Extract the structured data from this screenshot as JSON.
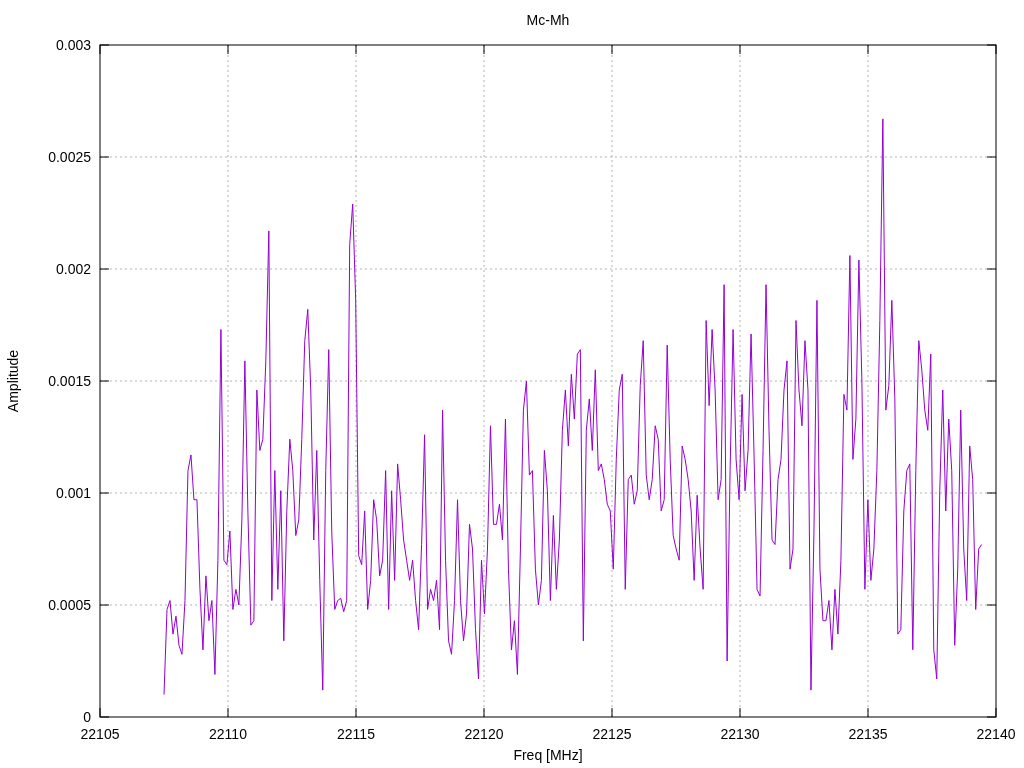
{
  "chart_data": {
    "type": "line",
    "grid": true,
    "title": "Mc-Mh",
    "xlabel": "Freq [MHz]",
    "ylabel": "Amplitude",
    "xlim": [
      22105,
      22140
    ],
    "ylim": [
      0,
      0.003
    ],
    "xticks": [
      22105,
      22110,
      22115,
      22120,
      22125,
      22130,
      22135,
      22140
    ],
    "yticks": [
      {
        "value": 0,
        "label": "0"
      },
      {
        "value": 0.0005,
        "label": "0.0005"
      },
      {
        "value": 0.001,
        "label": "0.001"
      },
      {
        "value": 0.0015,
        "label": "0.0015"
      },
      {
        "value": 0.002,
        "label": "0.002"
      },
      {
        "value": 0.0025,
        "label": "0.0025"
      },
      {
        "value": 0.003,
        "label": "0.003"
      }
    ],
    "x": [
      22107.5,
      22107.617,
      22107.734,
      22107.851,
      22107.968,
      22108.085,
      22108.202,
      22108.319,
      22108.436,
      22108.553,
      22108.67,
      22108.787,
      22108.904,
      22109.021,
      22109.138,
      22109.255,
      22109.372,
      22109.489,
      22109.606,
      22109.723,
      22109.84,
      22109.957,
      22110.074,
      22110.191,
      22110.308,
      22110.425,
      22110.542,
      22110.659,
      22110.776,
      22110.893,
      22111.01,
      22111.127,
      22111.244,
      22111.361,
      22111.478,
      22111.595,
      22111.712,
      22111.829,
      22111.946,
      22112.063,
      22112.18,
      22112.297,
      22112.414,
      22112.531,
      22112.648,
      22112.765,
      22112.882,
      22112.999,
      22113.116,
      22113.233,
      22113.35,
      22113.467,
      22113.584,
      22113.701,
      22113.818,
      22113.935,
      22114.052,
      22114.169,
      22114.286,
      22114.403,
      22114.52,
      22114.637,
      22114.754,
      22114.871,
      22114.988,
      22115.105,
      22115.222,
      22115.339,
      22115.456,
      22115.573,
      22115.69,
      22115.807,
      22115.924,
      22116.041,
      22116.158,
      22116.275,
      22116.392,
      22116.509,
      22116.626,
      22116.743,
      22116.86,
      22116.977,
      22117.094,
      22117.211,
      22117.328,
      22117.445,
      22117.562,
      22117.679,
      22117.796,
      22117.913,
      22118.03,
      22118.147,
      22118.264,
      22118.381,
      22118.498,
      22118.615,
      22118.732,
      22118.849,
      22118.966,
      22119.083,
      22119.2,
      22119.317,
      22119.434,
      22119.551,
      22119.668,
      22119.785,
      22119.902,
      22120.019,
      22120.136,
      22120.253,
      22120.37,
      22120.487,
      22120.604,
      22120.721,
      22120.838,
      22120.955,
      22121.072,
      22121.189,
      22121.306,
      22121.423,
      22121.54,
      22121.657,
      22121.774,
      22121.891,
      22122.008,
      22122.125,
      22122.242,
      22122.359,
      22122.476,
      22122.593,
      22122.71,
      22122.827,
      22122.944,
      22123.061,
      22123.178,
      22123.295,
      22123.412,
      22123.529,
      22123.646,
      22123.763,
      22123.88,
      22123.997,
      22124.114,
      22124.231,
      22124.348,
      22124.465,
      22124.582,
      22124.699,
      22124.816,
      22124.933,
      22125.05,
      22125.167,
      22125.284,
      22125.401,
      22125.518,
      22125.635,
      22125.752,
      22125.869,
      22125.986,
      22126.103,
      22126.22,
      22126.337,
      22126.454,
      22126.571,
      22126.688,
      22126.805,
      22126.922,
      22127.039,
      22127.156,
      22127.273,
      22127.39,
      22127.507,
      22127.624,
      22127.741,
      22127.858,
      22127.975,
      22128.092,
      22128.209,
      22128.326,
      22128.443,
      22128.56,
      22128.677,
      22128.794,
      22128.911,
      22129.028,
      22129.145,
      22129.262,
      22129.379,
      22129.496,
      22129.613,
      22129.73,
      22129.847,
      22129.964,
      22130.081,
      22130.198,
      22130.315,
      22130.432,
      22130.549,
      22130.666,
      22130.783,
      22130.9,
      22131.017,
      22131.134,
      22131.251,
      22131.368,
      22131.485,
      22131.602,
      22131.719,
      22131.836,
      22131.953,
      22132.07,
      22132.187,
      22132.304,
      22132.421,
      22132.538,
      22132.655,
      22132.772,
      22132.889,
      22133.006,
      22133.123,
      22133.24,
      22133.357,
      22133.474,
      22133.591,
      22133.708,
      22133.825,
      22133.942,
      22134.059,
      22134.176,
      22134.293,
      22134.41,
      22134.527,
      22134.644,
      22134.761,
      22134.878,
      22134.995,
      22135.112,
      22135.229,
      22135.346,
      22135.463,
      22135.58,
      22135.697,
      22135.814,
      22135.931,
      22136.048,
      22136.165,
      22136.282,
      22136.399,
      22136.516,
      22136.633,
      22136.75,
      22136.867,
      22136.984,
      22137.101,
      22137.218,
      22137.335,
      22137.452,
      22137.569,
      22137.686,
      22137.803,
      22137.92,
      22138.037,
      22138.154,
      22138.271,
      22138.388,
      22138.505,
      22138.622,
      22138.739,
      22138.856,
      22138.973,
      22139.09,
      22139.207,
      22139.324,
      22139.441
    ],
    "series": [
      {
        "color": "#9400d3",
        "values": [
          0.0001,
          0.00048,
          0.00052,
          0.00037,
          0.00045,
          0.00032,
          0.00028,
          0.00052,
          0.0011,
          0.00117,
          0.00097,
          0.00097,
          0.00057,
          0.0003,
          0.00063,
          0.00043,
          0.00052,
          0.00019,
          0.0007,
          0.00173,
          0.0007,
          0.00068,
          0.00083,
          0.00048,
          0.00057,
          0.0005,
          0.00088,
          0.00159,
          0.00092,
          0.00041,
          0.00043,
          0.00146,
          0.00119,
          0.00124,
          0.00159,
          0.00217,
          0.00052,
          0.0011,
          0.00057,
          0.00101,
          0.00034,
          0.00092,
          0.00124,
          0.0011,
          0.00081,
          0.00088,
          0.00124,
          0.00168,
          0.00182,
          0.00146,
          0.00079,
          0.00119,
          0.00061,
          0.00012,
          0.0011,
          0.00164,
          0.00083,
          0.00048,
          0.00052,
          0.00053,
          0.00047,
          0.00052,
          0.00211,
          0.00229,
          0.00186,
          0.00072,
          0.00068,
          0.00092,
          0.00048,
          0.00061,
          0.00097,
          0.00088,
          0.00063,
          0.0007,
          0.0011,
          0.00048,
          0.00101,
          0.00061,
          0.00113,
          0.00097,
          0.00079,
          0.0007,
          0.00061,
          0.0007,
          0.00052,
          0.00039,
          0.00077,
          0.00126,
          0.00048,
          0.00057,
          0.00052,
          0.00061,
          0.00039,
          0.00137,
          0.0007,
          0.00034,
          0.00028,
          0.00052,
          0.00097,
          0.00052,
          0.00034,
          0.00046,
          0.00086,
          0.00075,
          0.00039,
          0.00017,
          0.0007,
          0.00046,
          0.00075,
          0.0013,
          0.00086,
          0.00086,
          0.00095,
          0.00079,
          0.00133,
          0.00066,
          0.0003,
          0.00043,
          0.00019,
          0.00075,
          0.00137,
          0.0015,
          0.00108,
          0.0011,
          0.00066,
          0.0005,
          0.00061,
          0.00119,
          0.00101,
          0.00052,
          0.0009,
          0.00057,
          0.00079,
          0.00128,
          0.00146,
          0.00121,
          0.00153,
          0.00133,
          0.00162,
          0.00164,
          0.00034,
          0.00128,
          0.00142,
          0.00119,
          0.00155,
          0.0011,
          0.00113,
          0.00106,
          0.00095,
          0.00092,
          0.00066,
          0.00115,
          0.00146,
          0.00153,
          0.00057,
          0.00106,
          0.00108,
          0.00095,
          0.00101,
          0.00148,
          0.00168,
          0.00108,
          0.00097,
          0.00106,
          0.0013,
          0.00124,
          0.00092,
          0.00097,
          0.00166,
          0.00115,
          0.00081,
          0.00075,
          0.0007,
          0.00121,
          0.00115,
          0.00106,
          0.00092,
          0.00061,
          0.00099,
          0.00075,
          0.00057,
          0.00177,
          0.00139,
          0.00173,
          0.00146,
          0.00097,
          0.00106,
          0.00193,
          0.00025,
          0.0011,
          0.00173,
          0.00115,
          0.00097,
          0.00144,
          0.00101,
          0.00119,
          0.00171,
          0.00117,
          0.00057,
          0.00054,
          0.00119,
          0.00193,
          0.00128,
          0.00079,
          0.00077,
          0.00106,
          0.00115,
          0.00146,
          0.00159,
          0.00066,
          0.00075,
          0.00177,
          0.00146,
          0.0013,
          0.00168,
          0.00146,
          0.00012,
          0.00083,
          0.00186,
          0.00066,
          0.00043,
          0.00043,
          0.00052,
          0.0003,
          0.00057,
          0.00037,
          0.0007,
          0.00144,
          0.00137,
          0.00206,
          0.00115,
          0.00133,
          0.00204,
          0.0015,
          0.00057,
          0.00097,
          0.00061,
          0.00075,
          0.0011,
          0.00177,
          0.00267,
          0.00137,
          0.00148,
          0.00186,
          0.00142,
          0.00037,
          0.00039,
          0.00092,
          0.0011,
          0.00113,
          0.0003,
          0.0011,
          0.00168,
          0.00155,
          0.00137,
          0.00128,
          0.00162,
          0.0003,
          0.00017,
          0.00101,
          0.00146,
          0.00092,
          0.00133,
          0.0011,
          0.00032,
          0.00066,
          0.00137,
          0.00075,
          0.00052,
          0.00121,
          0.00106,
          0.00048,
          0.00075,
          0.00077
        ]
      }
    ]
  }
}
